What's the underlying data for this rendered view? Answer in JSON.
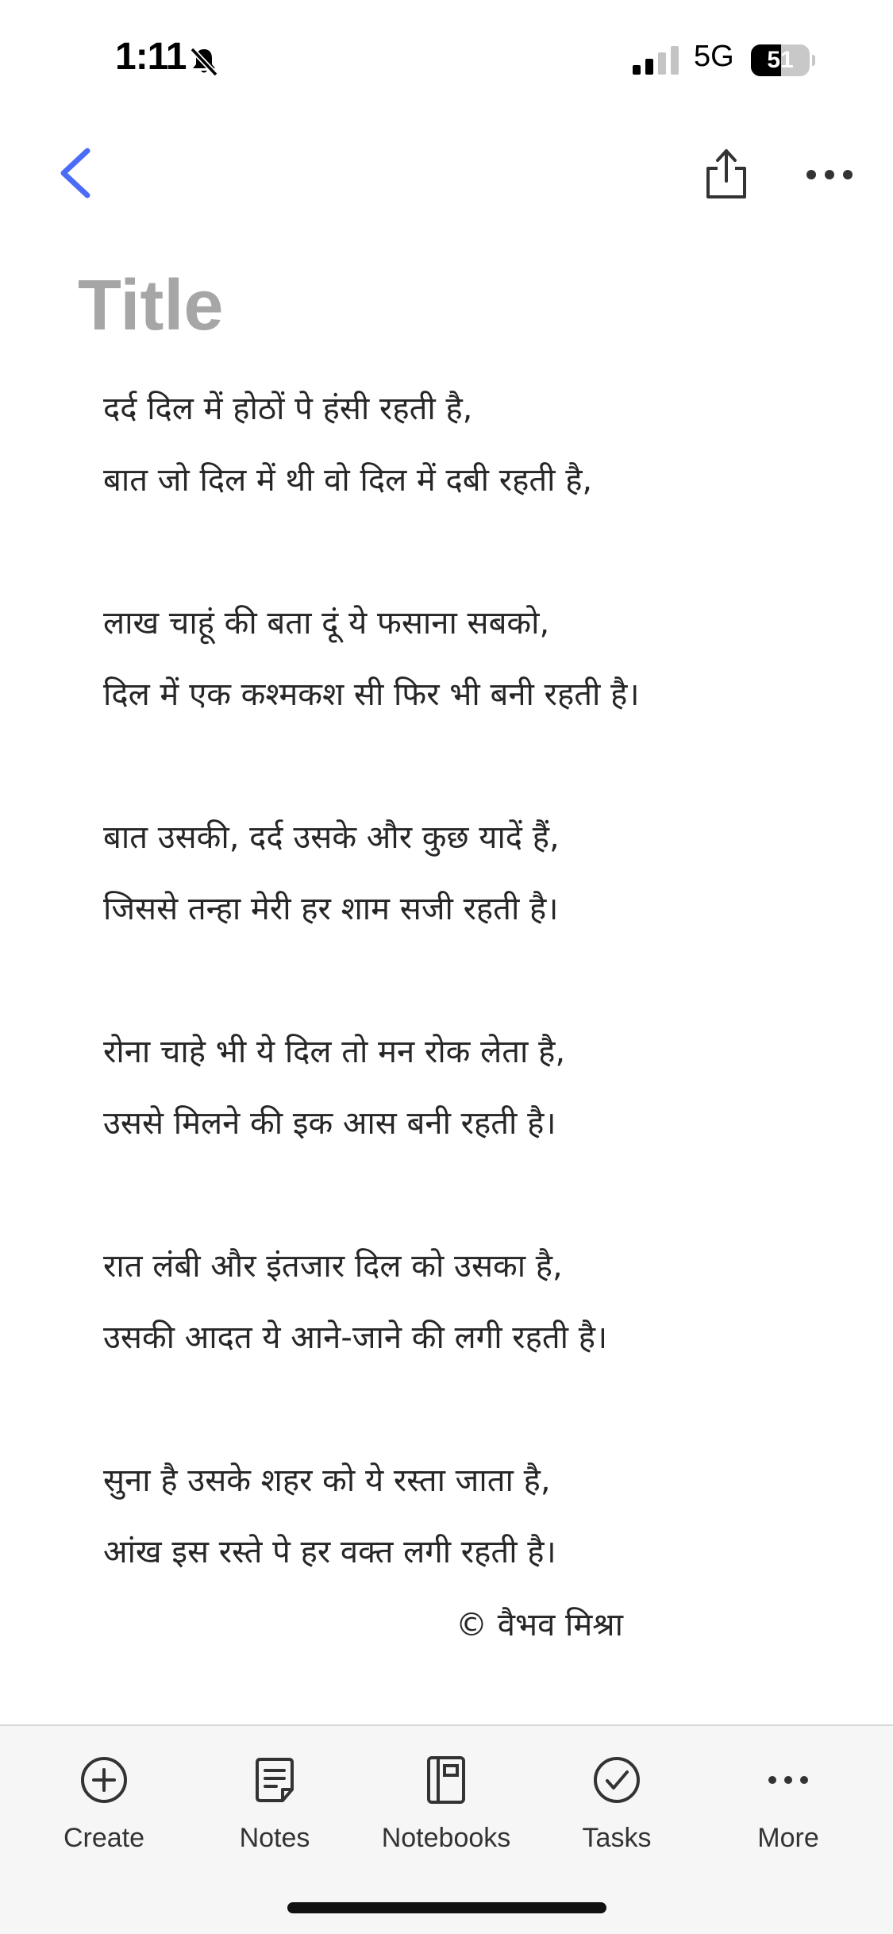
{
  "status_bar": {
    "time": "1:11",
    "network": "5G",
    "battery_percent": 51,
    "battery_label": "51"
  },
  "icons": {
    "back": "chevron-left-icon",
    "share": "share-icon",
    "more": "ellipsis-icon",
    "silent": "bell-slash-icon"
  },
  "note": {
    "title_placeholder": "Title",
    "lines": [
      "दर्द दिल में होठों पे हंसी रहती है,",
      "बात जो दिल में थी वो दिल में दबी रहती है,",
      "",
      "लाख चाहूं की बता दूं ये फसाना सबको,",
      "दिल में एक कश्मकश सी फिर भी बनी रहती है।",
      "",
      "बात उसकी, दर्द उसके और कुछ यादें हैं,",
      "जिससे तन्हा मेरी हर शाम सजी रहती है।",
      "",
      "रोना चाहे भी ये दिल तो मन रोक लेता है,",
      "उससे मिलने की इक आस बनी रहती है।",
      "",
      "रात लंबी और इंतजार दिल को उसका है,",
      "उसकी आदत ये आने-जाने की लगी रहती है।",
      "",
      "सुना है उसके शहर को ये रस्ता जाता है,",
      "आंख इस रस्ते पे हर वक्त लगी रहती है।"
    ],
    "signature": "© वैभव मिश्रा"
  },
  "bottom_nav": {
    "items": [
      {
        "label": "Create",
        "icon": "plus-circle-icon"
      },
      {
        "label": "Notes",
        "icon": "note-icon"
      },
      {
        "label": "Notebooks",
        "icon": "notebook-icon"
      },
      {
        "label": "Tasks",
        "icon": "check-circle-icon"
      },
      {
        "label": "More",
        "icon": "ellipsis-icon"
      }
    ]
  },
  "colors": {
    "accent": "#4a6cf7",
    "title_placeholder": "#a6a6a6",
    "text": "#262626",
    "nav_background": "#f6f6f6"
  }
}
